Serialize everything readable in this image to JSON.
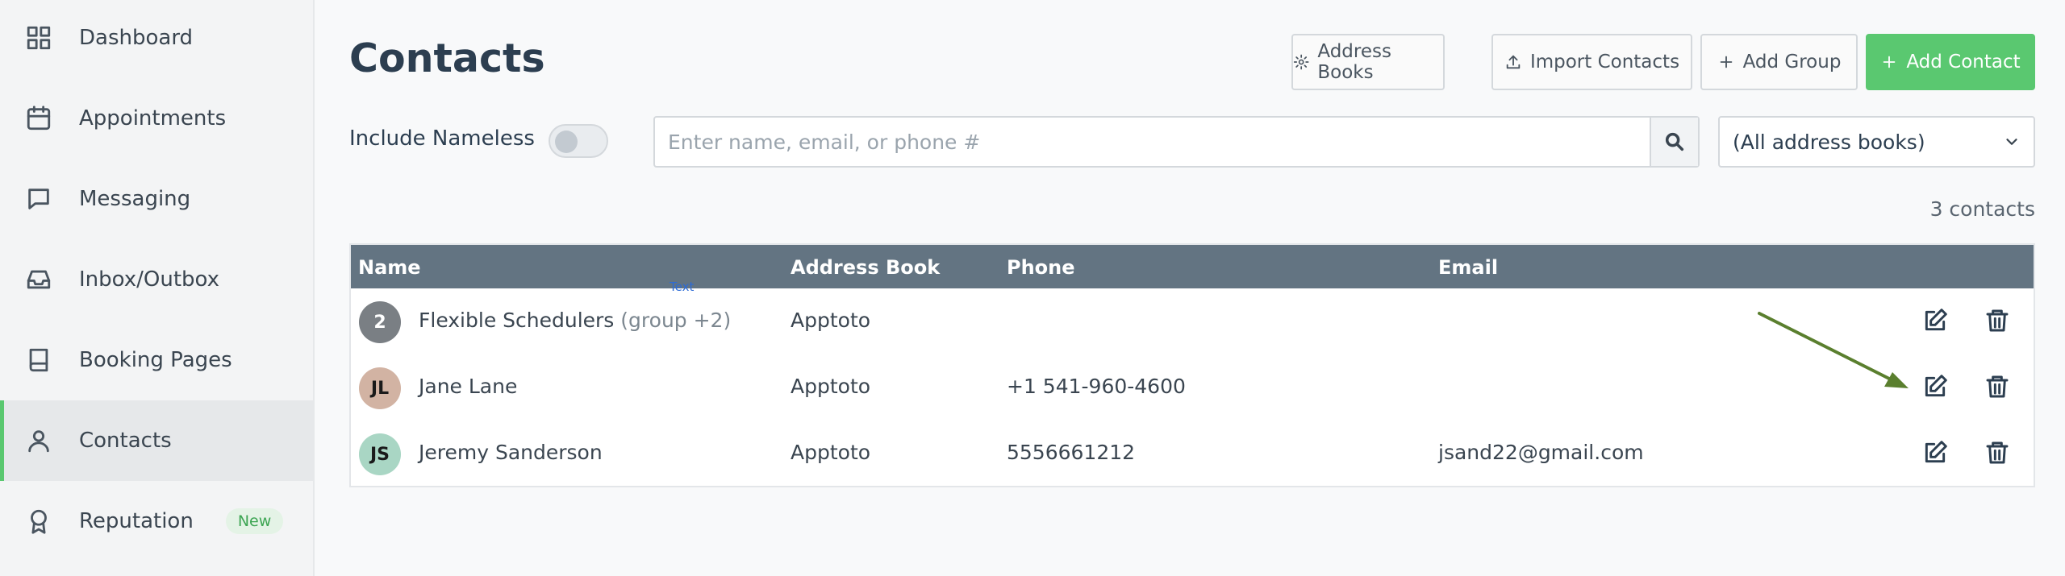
{
  "sidebar": {
    "items": [
      {
        "label": "Dashboard",
        "icon": "dashboard-icon"
      },
      {
        "label": "Appointments",
        "icon": "calendar-icon"
      },
      {
        "label": "Messaging",
        "icon": "message-icon"
      },
      {
        "label": "Inbox/Outbox",
        "icon": "inbox-icon"
      },
      {
        "label": "Booking Pages",
        "icon": "book-icon"
      },
      {
        "label": "Contacts",
        "icon": "user-icon",
        "active": true
      },
      {
        "label": "Reputation",
        "icon": "award-icon",
        "badge": "New"
      }
    ]
  },
  "header": {
    "title": "Contacts",
    "buttons": {
      "address_books": "Address Books",
      "import_contacts": "Import Contacts",
      "add_group": "Add Group",
      "add_contact": "Add Contact"
    }
  },
  "filters": {
    "include_nameless_label": "Include Nameless",
    "include_nameless_on": false,
    "search_placeholder": "Enter name, email, or phone #",
    "address_book_selected": "(All address books)"
  },
  "count_text": "3 contacts",
  "table": {
    "columns": [
      "Name",
      "Address Book",
      "Phone",
      "Email"
    ],
    "phone_hint": "Text",
    "rows": [
      {
        "avatar": "2",
        "name": "Flexible Schedulers",
        "suffix": "(group +2)",
        "address_book": "Apptoto",
        "phone": "",
        "email": "",
        "avatar_color": "#7a7f84"
      },
      {
        "avatar": "JL",
        "name": "Jane Lane",
        "suffix": "",
        "address_book": "Apptoto",
        "phone": "+1 541-960-4600",
        "email": "",
        "avatar_color": "#d2b3a3"
      },
      {
        "avatar": "JS",
        "name": "Jeremy Sanderson",
        "suffix": "",
        "address_book": "Apptoto",
        "phone": "5556661212",
        "email": "jsand22@gmail.com",
        "avatar_color": "#a9d6c4"
      }
    ]
  },
  "colors": {
    "accent": "#5ac870",
    "table_header": "#637482",
    "annotation_arrow": "#5a7f2e"
  }
}
